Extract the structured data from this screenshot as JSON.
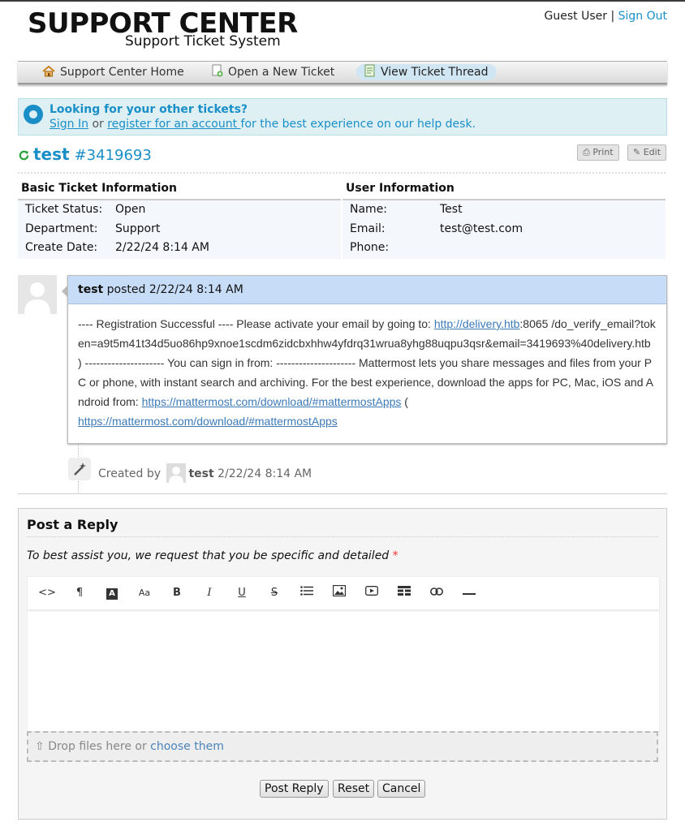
{
  "header": {
    "logo_main": "SUPPORT CENTER",
    "logo_sub": "Support Ticket System",
    "guest_label": "Guest User",
    "separator": "|",
    "sign_out": "Sign Out"
  },
  "nav": {
    "items": [
      {
        "label": "Support Center Home",
        "icon": "home-icon"
      },
      {
        "label": "Open a New Ticket",
        "icon": "new-ticket-icon"
      },
      {
        "label": "View Ticket Thread",
        "icon": "ticket-thread-icon",
        "active": true
      }
    ]
  },
  "notice": {
    "title": "Looking for your other tickets?",
    "sign_in": "Sign In",
    "or": " or ",
    "register": "register for an account ",
    "rest": "for the best experience on our help desk."
  },
  "ticket": {
    "subject": "test",
    "number": "#3419693",
    "print_label": "Print",
    "edit_label": "Edit"
  },
  "basic_info": {
    "heading": "Basic Ticket Information",
    "status_label": "Ticket Status:",
    "status_value": "Open",
    "department_label": "Department:",
    "department_value": "Support",
    "create_label": "Create Date:",
    "create_value": "2/22/24 8:14 AM"
  },
  "user_info": {
    "heading": "User Information",
    "name_label": "Name:",
    "name_value": "Test",
    "email_label": "Email:",
    "email_value": "test@test.com",
    "phone_label": "Phone:",
    "phone_value": ""
  },
  "thread": {
    "author": "test",
    "posted": " posted 2/22/24 8:14 AM",
    "body_part1": "---- Registration Successful ---- Please activate your email by going to: ",
    "link1": "http://delivery.htb",
    "body_part2": ":8065 /do_verify_email?token=a9t5m41t34d5uo86hp9xnoe1scdm6zidcbxhhw4yfdrq31wrua8yhg88uqpu3qsr&email=3419693%40delivery.htb ) --------------------- You can sign in from: --------------------- Mattermost lets you share messages and files from your PC or phone, with instant search and archiving. For the best experience, download the apps for PC, Mac, iOS and Android from: ",
    "link2": "https://mattermost.com/download/#mattermostApps",
    "body_part3": " ( ",
    "link3": "https://mattermost.com/download/#mattermostApps"
  },
  "event": {
    "created_by": "Created by",
    "author": "test",
    "time": " 2/22/24 8:14 AM"
  },
  "reply": {
    "heading": "Post a Reply",
    "hint": "To best assist you, we request that you be specific and detailed",
    "required_mark": "*",
    "toolbar": [
      "code-view-icon",
      "paragraph-icon",
      "font-color-icon",
      "font-size-icon",
      "bold-icon",
      "italic-icon",
      "underline-icon",
      "strikethrough-icon",
      "list-icon",
      "image-icon",
      "video-icon",
      "table-icon",
      "link-icon",
      "horizontal-rule-icon"
    ],
    "drop_text": "Drop files here or ",
    "choose": "choose them",
    "post_button": "Post Reply",
    "reset_button": "Reset",
    "cancel_button": "Cancel"
  },
  "colors": {
    "accent": "#1a8fc7",
    "thread_header": "#c6dcf7",
    "notice_bg": "#dff0f4"
  }
}
